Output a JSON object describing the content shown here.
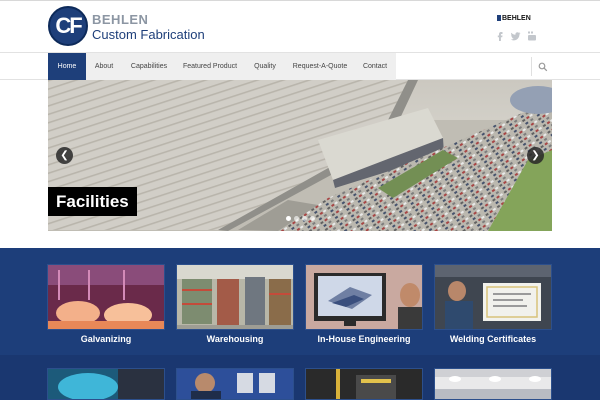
{
  "header": {
    "logo_initials": "CF",
    "logo_brand": "BEHLEN",
    "logo_tagline": "Custom Fabrication",
    "partner_logo": "BEHLEN",
    "social_icons": [
      "facebook-icon",
      "twitter-icon",
      "youtube-icon"
    ]
  },
  "nav": {
    "items": [
      {
        "label": "Home",
        "active": true
      },
      {
        "label": "About",
        "active": false
      },
      {
        "label": "Capabilities",
        "active": false
      },
      {
        "label": "Featured Product",
        "active": false
      },
      {
        "label": "Quality",
        "active": false
      },
      {
        "label": "Request-A-Quote",
        "active": false
      },
      {
        "label": "Contact",
        "active": false
      }
    ],
    "search_icon": "search-icon"
  },
  "slider": {
    "caption": "Facilities",
    "prev_icon": "chevron-left-icon",
    "next_icon": "chevron-right-icon",
    "prev_glyph": "❮",
    "next_glyph": "❯",
    "slide_count": 4,
    "active_slide": 1
  },
  "tiles": {
    "items": [
      {
        "label": "Galvanizing"
      },
      {
        "label": "Warehousing"
      },
      {
        "label": "In-House Engineering"
      },
      {
        "label": "Welding Certificates"
      }
    ]
  },
  "colors": {
    "brand_blue": "#1e3f7a",
    "tiles_background": "#1d3e7a",
    "nav_active": "#1e3f7a"
  }
}
